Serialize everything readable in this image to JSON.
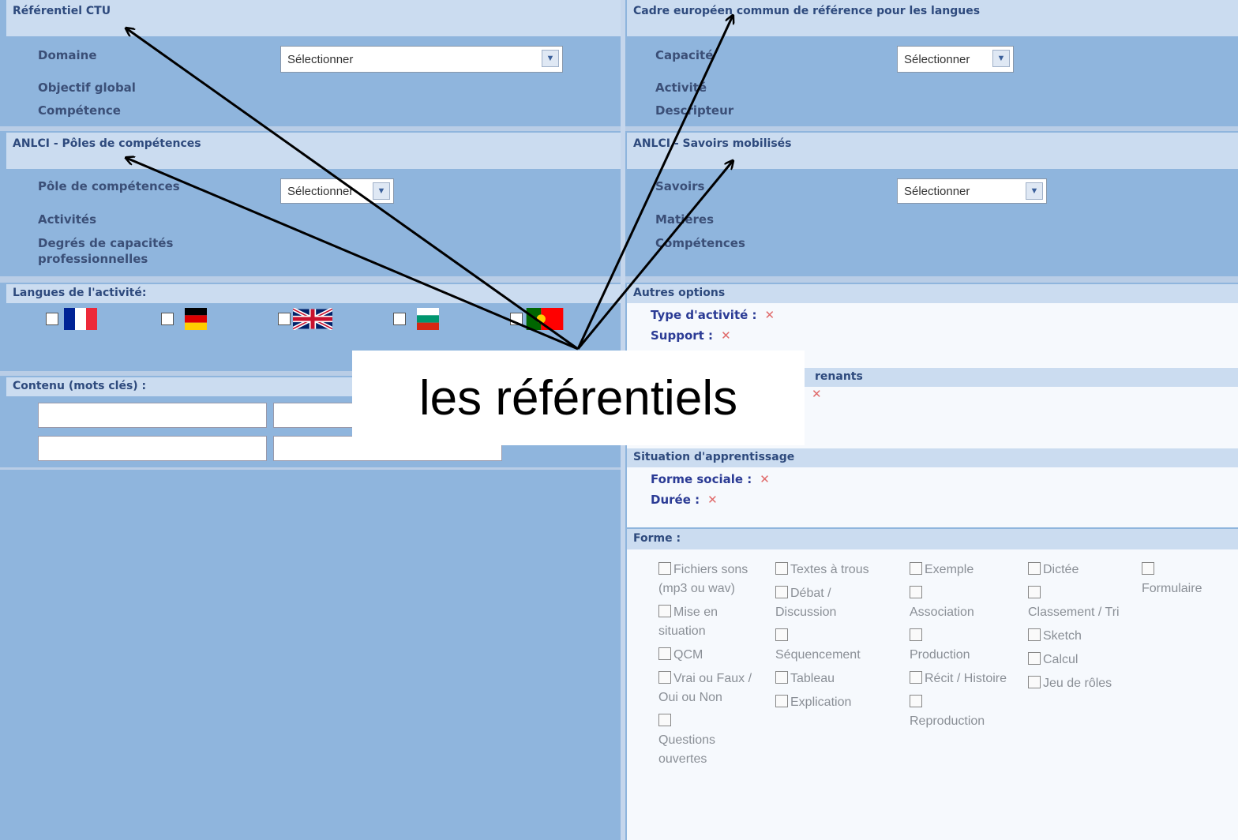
{
  "ctu": {
    "title": "Référentiel CTU",
    "domaine": "Domaine",
    "objectif": "Objectif global",
    "competence": "Compétence",
    "select": "Sélectionner"
  },
  "cecrl": {
    "title": "Cadre européen commun de référence pour les langues",
    "capacite": "Capacité",
    "activite": "Activité",
    "descripteur": "Descripteur",
    "select": "Sélectionner"
  },
  "anlci_poles": {
    "title": "ANLCI - Pôles de compétences",
    "pole": "Pôle de compétences",
    "activites": "Activités",
    "degres": "Degrés de capacités professionnelles",
    "select": "Sélectionner"
  },
  "anlci_savoirs": {
    "title": "ANLCI - Savoirs mobilisés",
    "savoirs": "Savoirs",
    "matieres": "Matières",
    "competences": "Compétences",
    "select": "Sélectionner"
  },
  "langues": {
    "title": "Langues de l'activité:",
    "flags": [
      "flag-fr",
      "flag-de",
      "flag-uk",
      "flag-bg",
      "flag-pt"
    ]
  },
  "contenu": {
    "title": "Contenu (mots clés) :"
  },
  "autres": {
    "title": "Autres options",
    "type": "Type d'activité :",
    "support": "Support :",
    "x": "✕"
  },
  "apprenants": {
    "title_visible": "renants",
    "x": "✕"
  },
  "situation": {
    "title": "Situation d'apprentissage",
    "forme_sociale": "Forme sociale :",
    "duree": "Durée :",
    "x": "✕"
  },
  "forme": {
    "title": "Forme :",
    "col1": [
      "Fichiers sons (mp3 ou wav)",
      "Mise en situation",
      "QCM",
      "Vrai ou Faux / Oui ou Non",
      "Questions ouvertes"
    ],
    "col2": [
      "Textes à trous",
      "Débat / Discussion",
      "Séquencement",
      "Tableau",
      "Explication"
    ],
    "col3": [
      "Exemple",
      "Association",
      "Production",
      "Récit / Histoire",
      "Reproduction"
    ],
    "col4": [
      "Dictée",
      "Classement / Tri",
      "Sketch",
      "Calcul",
      "Jeu de rôles"
    ],
    "col5": [
      "Formulaire"
    ]
  },
  "callout": {
    "text": "les référentiels"
  }
}
